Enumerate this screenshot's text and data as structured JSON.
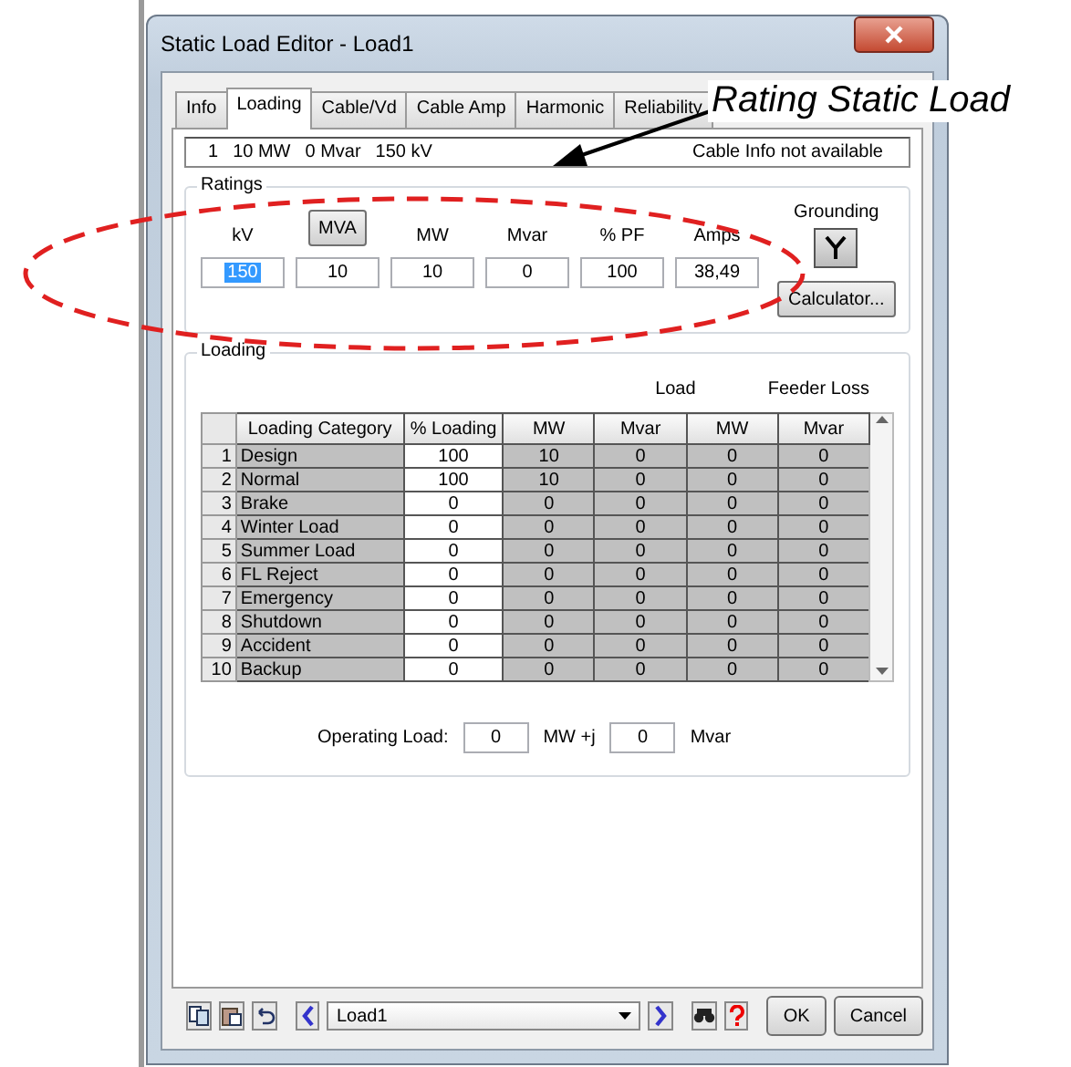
{
  "window": {
    "title": "Static Load Editor - Load1"
  },
  "tabs": [
    {
      "label": "Info",
      "selected": false
    },
    {
      "label": "Loading",
      "selected": true
    },
    {
      "label": "Cable/Vd",
      "selected": false
    },
    {
      "label": "Cable Amp",
      "selected": false
    },
    {
      "label": "Harmonic",
      "selected": false
    },
    {
      "label": "Reliability",
      "selected": false
    }
  ],
  "info_strip": {
    "summary": [
      "1",
      "10 MW",
      "0 Mvar",
      "150 kV"
    ],
    "cable_info": "Cable Info not available"
  },
  "ratings": {
    "title": "Ratings",
    "fields": [
      {
        "label": "kV",
        "kind": "label",
        "value": "150",
        "selected": true
      },
      {
        "label": "MVA",
        "kind": "button",
        "value": "10",
        "selected": false
      },
      {
        "label": "MW",
        "kind": "label",
        "value": "10",
        "selected": false
      },
      {
        "label": "Mvar",
        "kind": "label",
        "value": "0",
        "selected": false
      },
      {
        "label": "% PF",
        "kind": "label",
        "value": "100",
        "selected": false
      },
      {
        "label": "Amps",
        "kind": "label",
        "value": "38,49",
        "selected": false
      }
    ],
    "grounding": "Grounding",
    "calculator": "Calculator..."
  },
  "loading": {
    "title": "Loading",
    "group_headers": [
      "Load",
      "Feeder Loss"
    ],
    "columns": [
      "Loading Category",
      "% Loading",
      "MW",
      "Mvar",
      "MW",
      "Mvar"
    ],
    "rows": [
      {
        "index": "1",
        "cells": [
          "Design",
          "100",
          "10",
          "0",
          "0",
          "0"
        ]
      },
      {
        "index": "2",
        "cells": [
          "Normal",
          "100",
          "10",
          "0",
          "0",
          "0"
        ]
      },
      {
        "index": "3",
        "cells": [
          "Brake",
          "0",
          "0",
          "0",
          "0",
          "0"
        ]
      },
      {
        "index": "4",
        "cells": [
          "Winter Load",
          "0",
          "0",
          "0",
          "0",
          "0"
        ]
      },
      {
        "index": "5",
        "cells": [
          "Summer Load",
          "0",
          "0",
          "0",
          "0",
          "0"
        ]
      },
      {
        "index": "6",
        "cells": [
          "FL Reject",
          "0",
          "0",
          "0",
          "0",
          "0"
        ]
      },
      {
        "index": "7",
        "cells": [
          "Emergency",
          "0",
          "0",
          "0",
          "0",
          "0"
        ]
      },
      {
        "index": "8",
        "cells": [
          "Shutdown",
          "0",
          "0",
          "0",
          "0",
          "0"
        ]
      },
      {
        "index": "9",
        "cells": [
          "Accident",
          "0",
          "0",
          "0",
          "0",
          "0"
        ]
      },
      {
        "index": "10",
        "cells": [
          "Backup",
          "0",
          "0",
          "0",
          "0",
          "0"
        ]
      }
    ],
    "operating_load": {
      "label": "Operating Load:",
      "mw": "0",
      "mw_unit": "MW +j",
      "mvar": "0",
      "mvar_unit": "Mvar"
    }
  },
  "footer": {
    "selector": "Load1",
    "ok": "OK",
    "cancel": "Cancel"
  },
  "annotation": {
    "text": "Rating Static Load"
  }
}
